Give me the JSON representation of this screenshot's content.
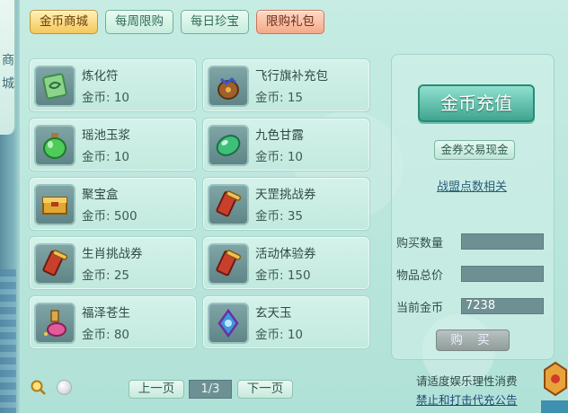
{
  "side_label": "商城",
  "tabs": [
    {
      "label": "金币商城"
    },
    {
      "label": "每周限购"
    },
    {
      "label": "每日珍宝"
    },
    {
      "label": "限购礼包"
    }
  ],
  "items": [
    {
      "name": "炼化符",
      "price": "金币: 10",
      "icon": "talisman-icon"
    },
    {
      "name": "飞行旗补充包",
      "price": "金币: 15",
      "icon": "pouch-icon"
    },
    {
      "name": "瑶池玉浆",
      "price": "金币: 10",
      "icon": "green-jar-icon"
    },
    {
      "name": "九色甘露",
      "price": "金币: 10",
      "icon": "green-gem-icon"
    },
    {
      "name": "聚宝盒",
      "price": "金币: 500",
      "icon": "gold-box-icon"
    },
    {
      "name": "天罡挑战券",
      "price": "金币: 35",
      "icon": "scroll-icon"
    },
    {
      "name": "生肖挑战券",
      "price": "金币: 25",
      "icon": "scroll-icon"
    },
    {
      "name": "活动体验券",
      "price": "金币: 150",
      "icon": "scroll-icon"
    },
    {
      "name": "福泽苍生",
      "price": "金币: 80",
      "icon": "potion-icon"
    },
    {
      "name": "玄天玉",
      "price": "金币: 10",
      "icon": "jade-icon"
    }
  ],
  "right_panel": {
    "recharge_label": "金币充值",
    "exchange_label": "金券交易现金",
    "alliance_link": "战盟点数相关",
    "quantity_label": "购买数量",
    "quantity_value": "",
    "total_label": "物品总价",
    "total_value": "",
    "balance_label": "当前金币",
    "balance_value": "7238",
    "buy_label": "购 买"
  },
  "pagination": {
    "prev_label": "上一页",
    "page": "1/3",
    "next_label": "下一页"
  },
  "notice": {
    "line1": "请适度娱乐理性消费",
    "line2": "禁止和打击代充公告"
  },
  "colors": {
    "panel_bg": "#b9e6dc",
    "active_tab": "#f4c75a",
    "special_tab": "#f3a987",
    "recharge": "#3fa58f"
  }
}
